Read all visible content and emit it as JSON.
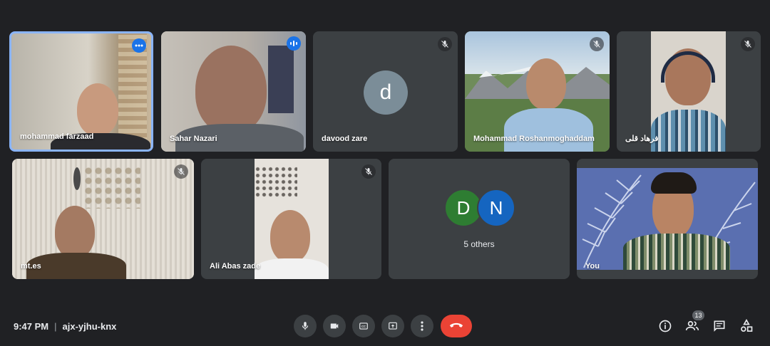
{
  "participants": [
    {
      "name": "mohammad farzaad",
      "status": "active-speaker"
    },
    {
      "name": "Sahar Nazari",
      "status": "speaking"
    },
    {
      "name": "davood zare",
      "status": "muted",
      "initial": "d"
    },
    {
      "name": "Mohammad Roshanmoghaddam",
      "status": "muted"
    },
    {
      "name": "فرهاد قلی",
      "status": "muted"
    },
    {
      "name": "mt.es",
      "status": "muted"
    },
    {
      "name": "Ali Abas zade",
      "status": "muted"
    },
    {
      "name": "You",
      "status": "self"
    }
  ],
  "others": {
    "label": "5 others",
    "initials": [
      "D",
      "N"
    ],
    "colors": [
      "#2e7d32",
      "#1565c0"
    ]
  },
  "meeting": {
    "time": "9:47 PM",
    "code": "ajx-yjhu-knx"
  },
  "people_count": "13",
  "colors": {
    "background": "#202124",
    "tile": "#3c4043",
    "accent": "#8ab4f8",
    "end_call": "#ea4335"
  },
  "controls": [
    "microphone-icon",
    "camera-icon",
    "captions-icon",
    "present-icon",
    "more-icon",
    "end-call-icon"
  ],
  "right_icons": [
    "info-icon",
    "people-icon",
    "chat-icon",
    "activities-icon"
  ]
}
